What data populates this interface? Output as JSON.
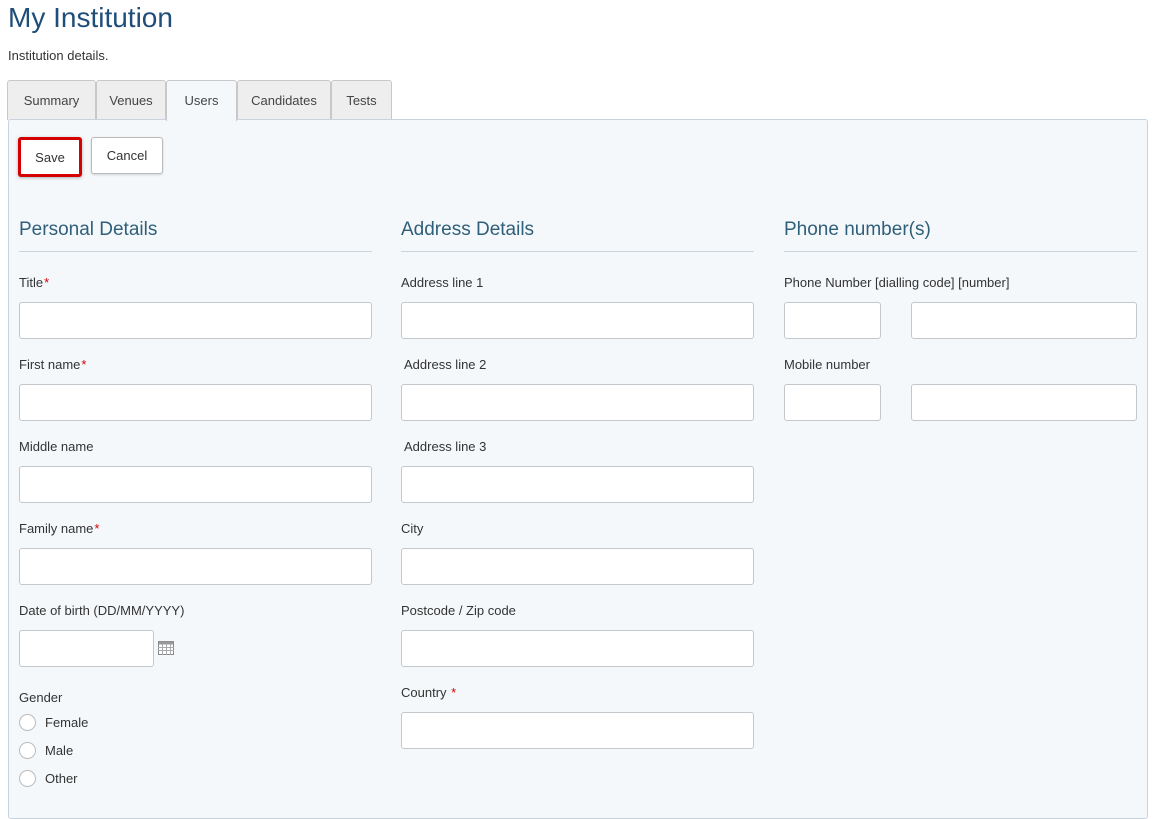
{
  "page": {
    "title": "My Institution",
    "subtitle": "Institution details."
  },
  "tabs": [
    {
      "label": "Summary",
      "active": false
    },
    {
      "label": "Venues",
      "active": false
    },
    {
      "label": "Users",
      "active": true
    },
    {
      "label": "Candidates",
      "active": false
    },
    {
      "label": "Tests",
      "active": false
    }
  ],
  "toolbar": {
    "save_label": "Save",
    "cancel_label": "Cancel"
  },
  "personal": {
    "heading": "Personal Details",
    "title_label": "Title",
    "first_name_label": "First name",
    "middle_name_label": "Middle name",
    "family_name_label": "Family name",
    "dob_label": "Date of birth (DD/MM/YYYY)",
    "gender_label": "Gender",
    "gender_options": [
      "Female",
      "Male",
      "Other"
    ],
    "required_mark": "*"
  },
  "address": {
    "heading": "Address Details",
    "line1_label": "Address line 1",
    "line2_label": "Address line 2",
    "line3_label": "Address line 3",
    "city_label": "City",
    "postcode_label": "Postcode / Zip code",
    "country_label": "Country",
    "required_mark": "*"
  },
  "phone": {
    "heading": "Phone number(s)",
    "phone_label": "Phone Number [dialling code] [number]",
    "mobile_label": "Mobile number"
  },
  "colors": {
    "title": "#1f4e79",
    "section_heading": "#2f5f7a",
    "required": "#d50000",
    "highlight": "#d50000",
    "panel_bg": "#f5f8fb"
  },
  "icons": {
    "date_picker": "calendar-icon"
  }
}
